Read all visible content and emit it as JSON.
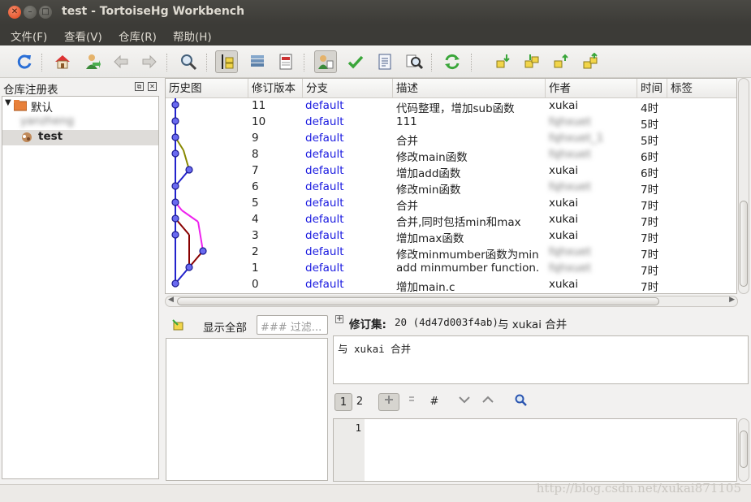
{
  "window": {
    "title": "test - TortoiseHg Workbench"
  },
  "menu": {
    "items": [
      "文件(F)",
      "查看(V)",
      "仓库(R)",
      "帮助(H)"
    ]
  },
  "toolbar": {
    "icons": [
      "refresh-icon",
      "home-icon",
      "goto-icon",
      "back-icon",
      "forward-icon",
      "find-icon",
      "graph-toggle-icon",
      "log-stack-icon",
      "log-icon",
      "user-filter-icon",
      "commit-icon",
      "manifest-icon",
      "search-icon",
      "sync-icon",
      "incoming-icon",
      "pull-icon",
      "outgoing-icon",
      "push-icon"
    ]
  },
  "repo_registry": {
    "title": "仓库注册表",
    "group": "默认",
    "items": [
      "yanzheng",
      "test"
    ]
  },
  "log_table": {
    "headers": [
      "历史图",
      "修订版本",
      "分支",
      "描述",
      "作者",
      "时间",
      "标签"
    ],
    "rows": [
      {
        "rev": "11",
        "branch": "default",
        "desc": "代码整理，增加sub函数",
        "author": "xukai",
        "author_blurred": false,
        "age": "4时"
      },
      {
        "rev": "10",
        "branch": "default",
        "desc": "111",
        "author": "fqhxuet",
        "author_blurred": true,
        "age": "5时"
      },
      {
        "rev": "9",
        "branch": "default",
        "desc": "合并",
        "author": "fqhxuet_1",
        "author_blurred": true,
        "age": "5时"
      },
      {
        "rev": "8",
        "branch": "default",
        "desc": "修改main函数",
        "author": "fqhxuet",
        "author_blurred": true,
        "age": "6时"
      },
      {
        "rev": "7",
        "branch": "default",
        "desc": "增加add函数",
        "author": "xukai",
        "author_blurred": false,
        "age": "6时"
      },
      {
        "rev": "6",
        "branch": "default",
        "desc": "修改min函数",
        "author": "fqhxuet",
        "author_blurred": true,
        "age": "7时"
      },
      {
        "rev": "5",
        "branch": "default",
        "desc": "合并",
        "author": "xukai",
        "author_blurred": false,
        "age": "7时"
      },
      {
        "rev": "4",
        "branch": "default",
        "desc": "合并,同时包括min和max",
        "author": "xukai",
        "author_blurred": false,
        "age": "7时"
      },
      {
        "rev": "3",
        "branch": "default",
        "desc": "增加max函数",
        "author": "xukai",
        "author_blurred": false,
        "age": "7时"
      },
      {
        "rev": "2",
        "branch": "default",
        "desc": "修改minmumber函数为min",
        "author": "fqhxuet",
        "author_blurred": true,
        "age": "7时"
      },
      {
        "rev": "1",
        "branch": "default",
        "desc": "add minmumber function.",
        "author": "fqhxuet",
        "author_blurred": true,
        "age": "7时"
      },
      {
        "rev": "0",
        "branch": "default",
        "desc": "增加main.c",
        "author": "xukai",
        "author_blurred": false,
        "age": "7时"
      }
    ]
  },
  "file_list": {
    "show_all_label": "显示全部",
    "filter_placeholder": "### 过滤..."
  },
  "revision": {
    "label": "修订集:",
    "id": "20 (4d47d003f4ab)",
    "summary": "与 xukai 合并",
    "message": "与 xukai 合并"
  },
  "diff_toolbar": {
    "tab1": "1",
    "tab2": "2",
    "hash": "#"
  },
  "diff": {
    "line_number": "1"
  },
  "watermark": "http://blog.csdn.net/xukai871105",
  "colors": {
    "branch_text": "#1a1ae0",
    "graph_main": "#2222cc",
    "graph_magenta": "#ee22ee",
    "graph_olive": "#888800",
    "graph_darkred": "#880000",
    "titlebar": "#3c3b37"
  }
}
